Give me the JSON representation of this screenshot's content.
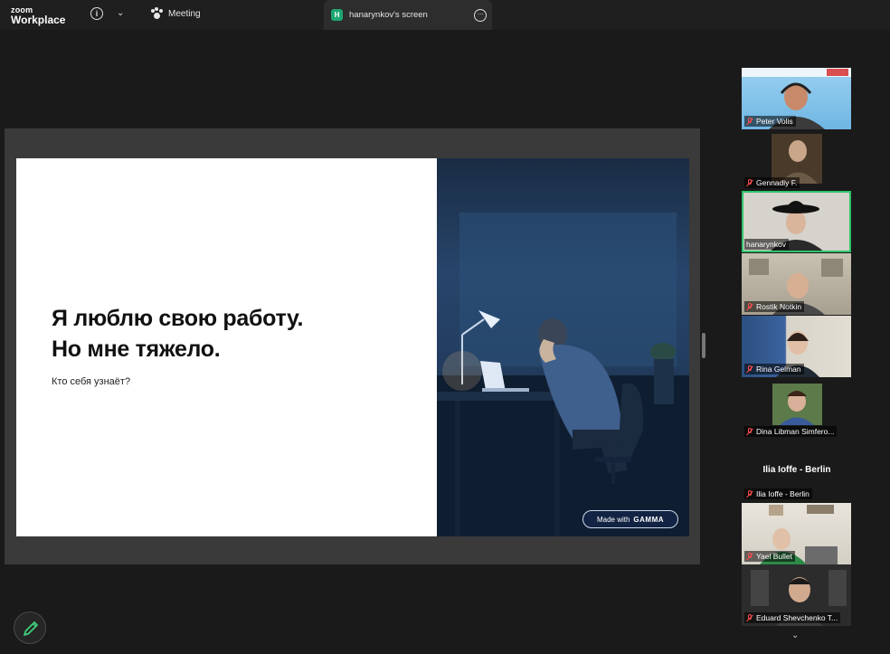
{
  "topbar": {
    "logo_line1": "zoom",
    "logo_line2": "Workplace",
    "meeting_label": "Meeting",
    "share_badge": "H",
    "share_tab_label": "hanarynkov's screen"
  },
  "slide": {
    "headline_line1": "Я люблю свою работу.",
    "headline_line2": "Но мне тяжело.",
    "subline": "Кто себя узнаёт?",
    "badge_prefix": "Made with",
    "badge_brand": "GAMMA"
  },
  "participants": [
    {
      "name": "Peter Volis"
    },
    {
      "name": "Gennadiy F."
    },
    {
      "name": "hanarynkov"
    },
    {
      "name": "Rostik Notkin"
    },
    {
      "name": "Rina Gelman"
    },
    {
      "name": "Dina Libman Simfero..."
    },
    {
      "name": "Ilia Ioffe - Berlin"
    },
    {
      "name": "Yael Bullet"
    },
    {
      "name": "Eduard Shevchenko T..."
    }
  ],
  "name_only_title": "Ilia Ioffe - Berlin",
  "colors": {
    "active_speaker": "#2ec46a",
    "share_badge": "#1ea672",
    "annotate_icon": "#3ecf7a"
  }
}
